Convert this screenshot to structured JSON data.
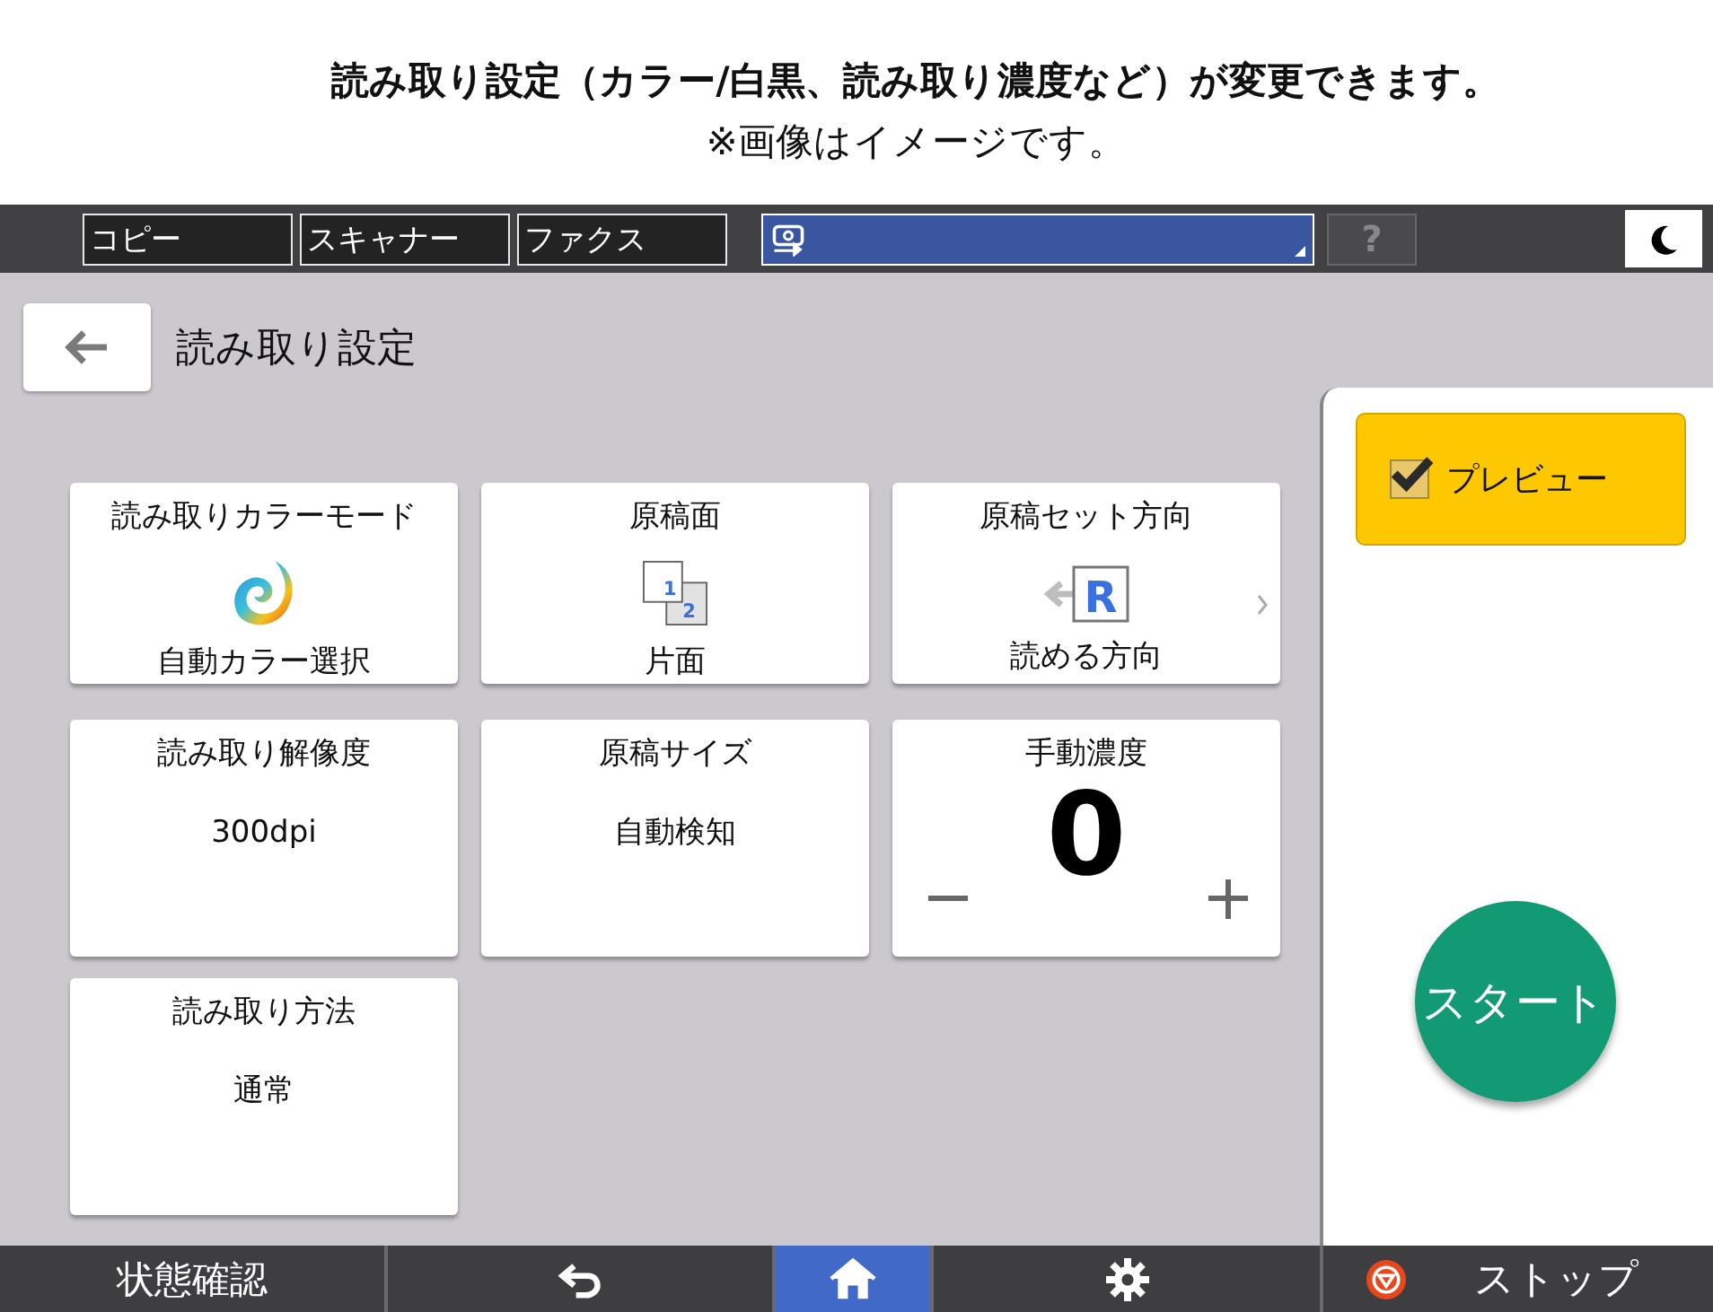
{
  "caption": {
    "lines": [
      "読み取り設定（カラー/白黒、読み取り濃度など）が変更できます。",
      "※画像はイメージです。"
    ]
  },
  "top_bar": {
    "tabs": [
      {
        "label": "コピー",
        "selected": false
      },
      {
        "label": "スキャナー",
        "selected": false
      },
      {
        "label": "ファクス",
        "selected": false
      }
    ],
    "help": {
      "label": "?",
      "disabled": true
    }
  },
  "page": {
    "title": "読み取り設定"
  },
  "tiles": [
    {
      "kind": "icon",
      "label": "読み取りカラーモード",
      "icon": {
        "kind": "swirl"
      },
      "value": "自動カラー選択"
    },
    {
      "kind": "icon",
      "label": "原稿面",
      "icon": {
        "kind": "pages",
        "labels": [
          "1",
          "2"
        ]
      },
      "value": "片面"
    },
    {
      "kind": "icon",
      "label": "原稿セット方向",
      "icon": {
        "kind": "orientation",
        "labels": [
          "R"
        ]
      },
      "value": "読める方向",
      "more": true
    },
    {
      "kind": "text",
      "label": "読み取り解像度",
      "value": "300dpi"
    },
    {
      "kind": "text",
      "label": "原稿サイズ",
      "value": "自動検知"
    },
    {
      "kind": "counter",
      "label": "手動濃度",
      "value": "0"
    },
    {
      "kind": "text",
      "label": "読み取り方法",
      "value": "通常"
    }
  ],
  "side_panel": {
    "preview": {
      "label": "プレビュー",
      "checked": true
    },
    "start": {
      "label": "スタート"
    }
  },
  "bottom_bar": {
    "status": {
      "label": "状態確認"
    },
    "nav": [
      {
        "kind": "back",
        "selected": false
      },
      {
        "kind": "home",
        "selected": true
      },
      {
        "kind": "settings",
        "selected": false
      }
    ],
    "stop": {
      "label": "ストップ"
    }
  }
}
